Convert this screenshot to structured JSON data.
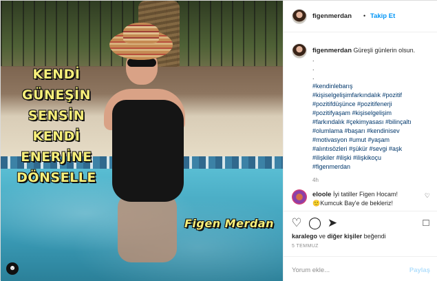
{
  "photo": {
    "overlay_lines": [
      "KENDİ",
      "GÜNEŞİN",
      "SENSİN",
      "KENDİ",
      "ENERJİNE",
      "DÖNSELLE"
    ],
    "signature": "Figen Merdan",
    "shield_icon": "person-shield-icon"
  },
  "header": {
    "username": "figenmerdan",
    "separator": "•",
    "follow_label": "Takip Et"
  },
  "caption": {
    "username": "figenmerdan",
    "text": "Güreşli günlerin olsun.",
    "dots": [
      ".",
      ".",
      "."
    ],
    "hashtags": [
      "#kendinlebarış",
      "#kişiselgelişimfarkındalık #pozitif",
      "#pozitifdüşünce #pozitifenerji",
      "#pozitifyaşam #kişiselgelişim",
      "#farkındalık #çekimyasası #bilinçaltı",
      "#olumlama #başarı #kendinisev",
      "#motivasyon #umut #yaşam",
      "#alıntısözleri #şükür #sevgi #aşk",
      "#ilişkiler #ilişki #ilişkikoçu",
      "#figenmerdan"
    ],
    "time": "4h"
  },
  "comment": {
    "username": "eloole",
    "text": "İyi tatiller Figen Hocam!",
    "text2": "Kumcuk Bay'e de bekleriz!",
    "emoji": "🙂"
  },
  "actions": {
    "likes_user": "karalego",
    "likes_mid": " ve ",
    "likes_others": "diğer kişiler",
    "likes_end": " beğendi",
    "date": "5 TEMMUZ"
  },
  "add_comment": {
    "placeholder": "Yorum ekle...",
    "post_label": "Paylaş"
  }
}
